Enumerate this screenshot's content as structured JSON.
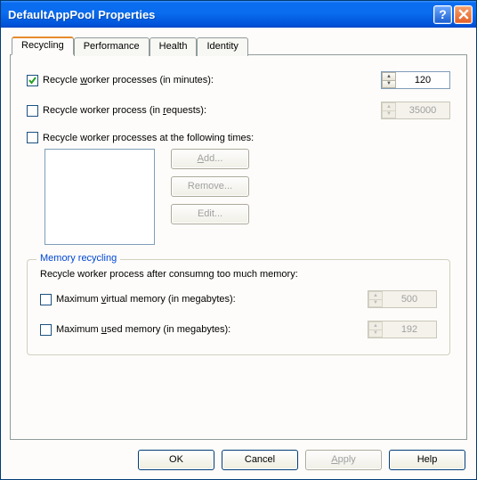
{
  "window": {
    "title": "DefaultAppPool Properties"
  },
  "tabs": {
    "recycling": "Recycling",
    "performance": "Performance",
    "health": "Health",
    "identity": "Identity"
  },
  "recycling": {
    "proc_minutes_label_pre": "Recycle ",
    "proc_minutes_hot": "w",
    "proc_minutes_label_post": "orker processes (in minutes):",
    "proc_minutes_value": "120",
    "proc_requests_label_pre": "Recycle worker process (in ",
    "proc_requests_hot": "r",
    "proc_requests_label_post": "equests):",
    "proc_requests_value": "35000",
    "times_label": "Recycle worker processes at the following times:",
    "add_btn": "Add...",
    "remove_btn": "Remove...",
    "edit_btn": "Edit..."
  },
  "memory": {
    "legend": "Memory recycling",
    "desc": "Recycle worker process after consumng too much memory:",
    "virtual_pre": "Maximum ",
    "virtual_hot": "v",
    "virtual_post": "irtual memory (in megabytes):",
    "virtual_value": "500",
    "used_pre": "Maximum ",
    "used_hot": "u",
    "used_post": "sed memory (in megabytes):",
    "used_value": "192"
  },
  "buttons": {
    "ok": "OK",
    "cancel": "Cancel",
    "apply": "Apply",
    "help": "Help"
  }
}
